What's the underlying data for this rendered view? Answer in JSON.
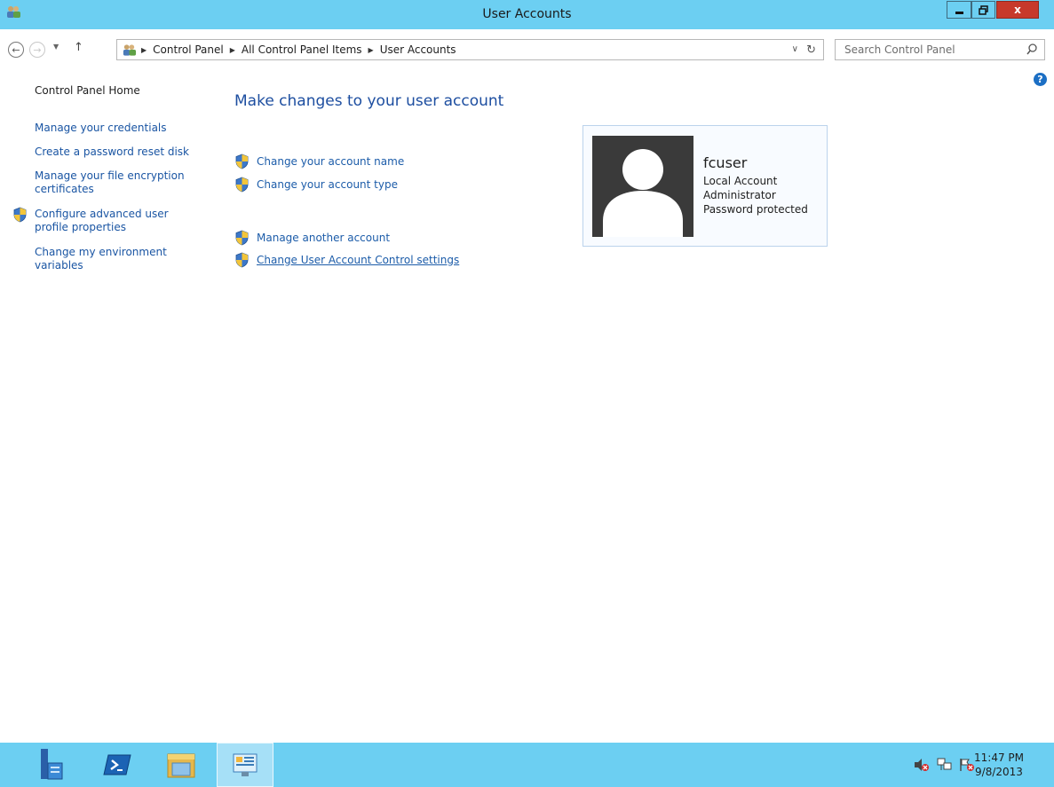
{
  "window": {
    "title": "User Accounts",
    "close_label": "x"
  },
  "address": {
    "crumbs": [
      "Control Panel",
      "All Control Panel Items",
      "User Accounts"
    ],
    "search_placeholder": "Search Control Panel"
  },
  "help": {
    "label": "?"
  },
  "left_nav": {
    "home": "Control Panel Home",
    "items": [
      "Manage your credentials",
      "Create a password reset disk",
      "Manage your file encryption certificates",
      "Configure advanced user profile properties",
      "Change my environment variables"
    ]
  },
  "main": {
    "title": "Make changes to your user account",
    "tasks": [
      "Change your account name",
      "Change your account type",
      "Manage another account",
      "Change User Account Control settings"
    ]
  },
  "account": {
    "name": "fcuser",
    "type": "Local Account",
    "role": "Administrator",
    "status": "Password protected"
  },
  "taskbar": {
    "time": "11:47 PM",
    "date": "9/8/2013"
  },
  "colors": {
    "titlebar": "#6ccff2",
    "link": "#1c5ca9",
    "heading": "#1d4ea0",
    "close": "#c7392b"
  }
}
